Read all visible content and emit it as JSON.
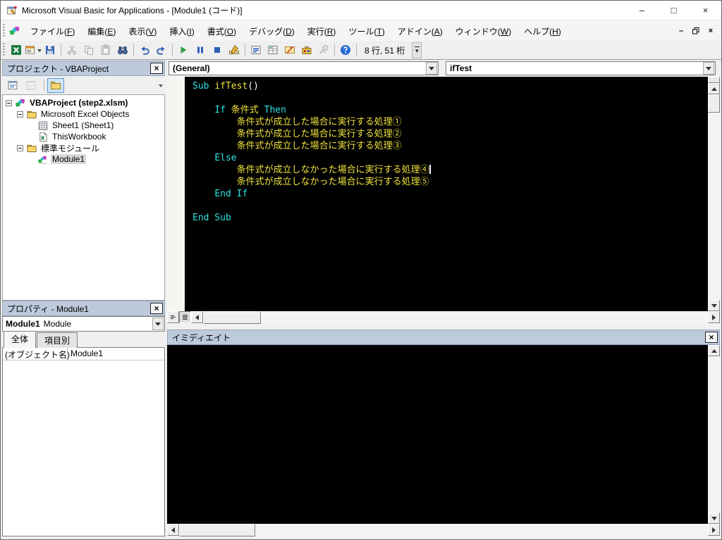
{
  "colors": {
    "keyword": "#2fe2e2",
    "identifier": "#f0e23c",
    "plain": "#ffffff",
    "code_bg": "#000000",
    "header_bg": "#bccadc"
  },
  "glyphs": {
    "minimize": "–",
    "maximize": "□",
    "close": "×",
    "overflow": "▾"
  },
  "title_bar": {
    "title": "Microsoft Visual Basic for Applications - [Module1 (コード)]"
  },
  "menu_bar": {
    "items": [
      {
        "label": "ファイル(F)"
      },
      {
        "label": "編集(E)"
      },
      {
        "label": "表示(V)"
      },
      {
        "label": "挿入(I)"
      },
      {
        "label": "書式(O)"
      },
      {
        "label": "デバッグ(D)"
      },
      {
        "label": "実行(R)"
      },
      {
        "label": "ツール(T)"
      },
      {
        "label": "アドイン(A)"
      },
      {
        "label": "ウィンドウ(W)"
      },
      {
        "label": "ヘルプ(H)"
      }
    ]
  },
  "toolbar": {
    "position_text": "8 行, 51 桁",
    "groups": [
      {
        "icons": [
          {
            "name": "view-excel-icon"
          },
          {
            "name": "insert-userform-icon",
            "dropdown": true
          },
          {
            "name": "save-icon"
          }
        ]
      },
      {
        "icons": [
          {
            "name": "cut-icon",
            "disabled": true
          },
          {
            "name": "copy-icon",
            "disabled": true
          },
          {
            "name": "paste-icon",
            "disabled": true
          },
          {
            "name": "find-icon"
          }
        ]
      },
      {
        "icons": [
          {
            "name": "undo-icon"
          },
          {
            "name": "redo-icon"
          }
        ]
      },
      {
        "icons": [
          {
            "name": "run-icon"
          },
          {
            "name": "break-icon"
          },
          {
            "name": "reset-icon"
          },
          {
            "name": "design-mode-icon"
          }
        ]
      },
      {
        "icons": [
          {
            "name": "project-explorer-icon"
          },
          {
            "name": "properties-window-icon"
          },
          {
            "name": "object-browser-icon"
          },
          {
            "name": "toolbox-icon"
          },
          {
            "name": "options-icon",
            "disabled": true
          }
        ]
      },
      {
        "icons": [
          {
            "name": "help-icon"
          }
        ]
      }
    ]
  },
  "project_panel": {
    "title": "プロジェクト - VBAProject",
    "tools": [
      {
        "name": "view-code-icon"
      },
      {
        "name": "view-object-icon",
        "disabled": true
      },
      {
        "name": "toggle-folders-icon",
        "active": true,
        "separator_before": true
      }
    ],
    "tree": [
      {
        "depth": 0,
        "expander": true,
        "icon": "project-icon",
        "label": "VBAProject (step2.xlsm)",
        "bold": true
      },
      {
        "depth": 1,
        "expander": true,
        "icon": "folder-icon",
        "label": "Microsoft Excel Objects"
      },
      {
        "depth": 2,
        "expander": false,
        "icon": "sheet-icon",
        "label": "Sheet1 (Sheet1)"
      },
      {
        "depth": 2,
        "expander": false,
        "icon": "workbook-icon",
        "label": "ThisWorkbook"
      },
      {
        "depth": 1,
        "expander": true,
        "icon": "folder-icon",
        "label": "標準モジュール"
      },
      {
        "depth": 2,
        "expander": false,
        "icon": "module-icon",
        "label": "Module1",
        "selected": true
      }
    ]
  },
  "properties_panel": {
    "title": "プロパティ - Module1",
    "selector_name": "Module1",
    "selector_type": "Module",
    "tabs": [
      {
        "label": "全体",
        "active": true
      },
      {
        "label": "項目別",
        "active": false
      }
    ],
    "rows": [
      {
        "name": "(オブジェクト名)",
        "value": "Module1"
      }
    ]
  },
  "code_window": {
    "object_dropdown": "(General)",
    "procedure_dropdown": "ifTest",
    "lines": [
      [
        {
          "t": "Sub",
          "c": "kw"
        },
        {
          "t": " "
        },
        {
          "t": "ifTest",
          "c": "id"
        },
        {
          "t": "()"
        }
      ],
      [],
      [
        {
          "t": "    "
        },
        {
          "t": "If",
          "c": "kw"
        },
        {
          "t": " "
        },
        {
          "t": "条件式",
          "c": "id"
        },
        {
          "t": " "
        },
        {
          "t": "Then",
          "c": "kw"
        }
      ],
      [
        {
          "t": "        "
        },
        {
          "t": "条件式が成立した場合に実行する処理①",
          "c": "id"
        }
      ],
      [
        {
          "t": "        "
        },
        {
          "t": "条件式が成立した場合に実行する処理②",
          "c": "id"
        }
      ],
      [
        {
          "t": "        "
        },
        {
          "t": "条件式が成立した場合に実行する処理③",
          "c": "id"
        }
      ],
      [
        {
          "t": "    "
        },
        {
          "t": "Else",
          "c": "kw"
        }
      ],
      [
        {
          "t": "        "
        },
        {
          "t": "条件式が成立しなかった場合に実行する処理④",
          "c": "id"
        },
        {
          "caret": true
        }
      ],
      [
        {
          "t": "        "
        },
        {
          "t": "条件式が成立しなかった場合に実行する処理⑤",
          "c": "id"
        }
      ],
      [
        {
          "t": "    "
        },
        {
          "t": "End If",
          "c": "kw"
        }
      ],
      [],
      [
        {
          "t": "End Sub",
          "c": "kw"
        }
      ]
    ]
  },
  "immediate_panel": {
    "title": "イミディエイト"
  }
}
